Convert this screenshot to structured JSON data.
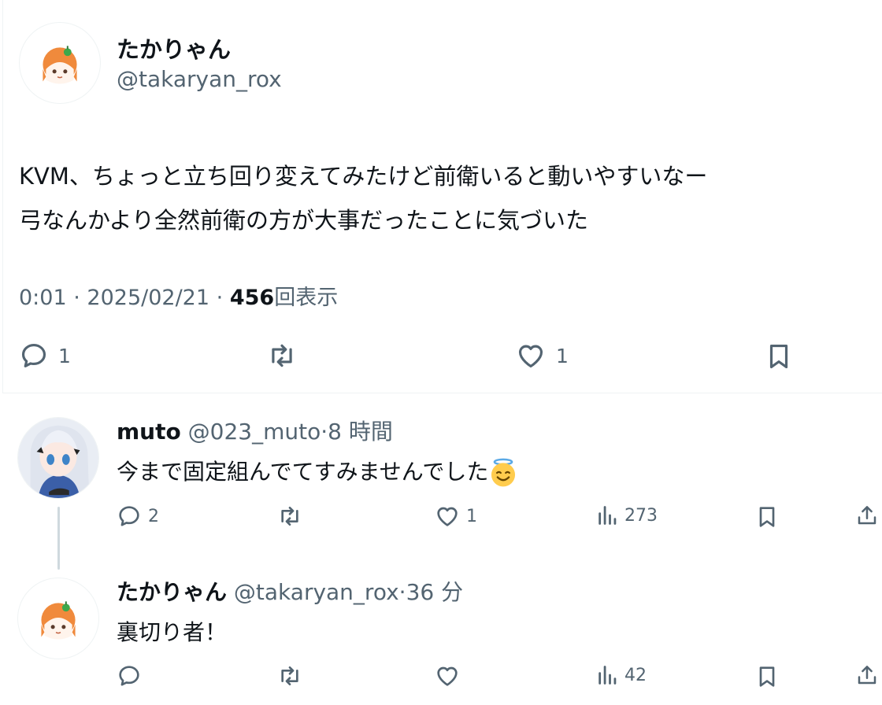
{
  "main_tweet": {
    "author_name": "たかりゃん",
    "author_handle": "@takaryan_rox",
    "text_line1": "KVM、ちょっと立ち回り変えてみたけど前衛いると動いやすいなー",
    "text_line2": "弓なんかより全然前衛の方が大事だったことに気づいた",
    "time": "0:01",
    "date": "2025/02/21",
    "views_count": "456",
    "views_label": "回表示",
    "replies_count": "1",
    "likes_count": "1"
  },
  "replies": [
    {
      "author_name": "muto",
      "author_handle": "@023_muto",
      "time_ago": "8 時間",
      "text": "今まで固定組んでてすみませんでした",
      "replies_count": "2",
      "likes_count": "1",
      "views_count": "273"
    },
    {
      "author_name": "たかりゃん",
      "author_handle": "@takaryan_rox",
      "time_ago": "36 分",
      "text": "裏切り者！",
      "views_count": "42"
    }
  ],
  "separator_dot": "·",
  "colors": {
    "text_primary": "#0f1419",
    "text_secondary": "#536471",
    "divider": "#eff3f4",
    "thread_line": "#cfd9de"
  },
  "icons": [
    "reply-icon",
    "retweet-icon",
    "like-icon",
    "bookmark-icon",
    "views-icon",
    "share-icon",
    "halo-emoji"
  ]
}
